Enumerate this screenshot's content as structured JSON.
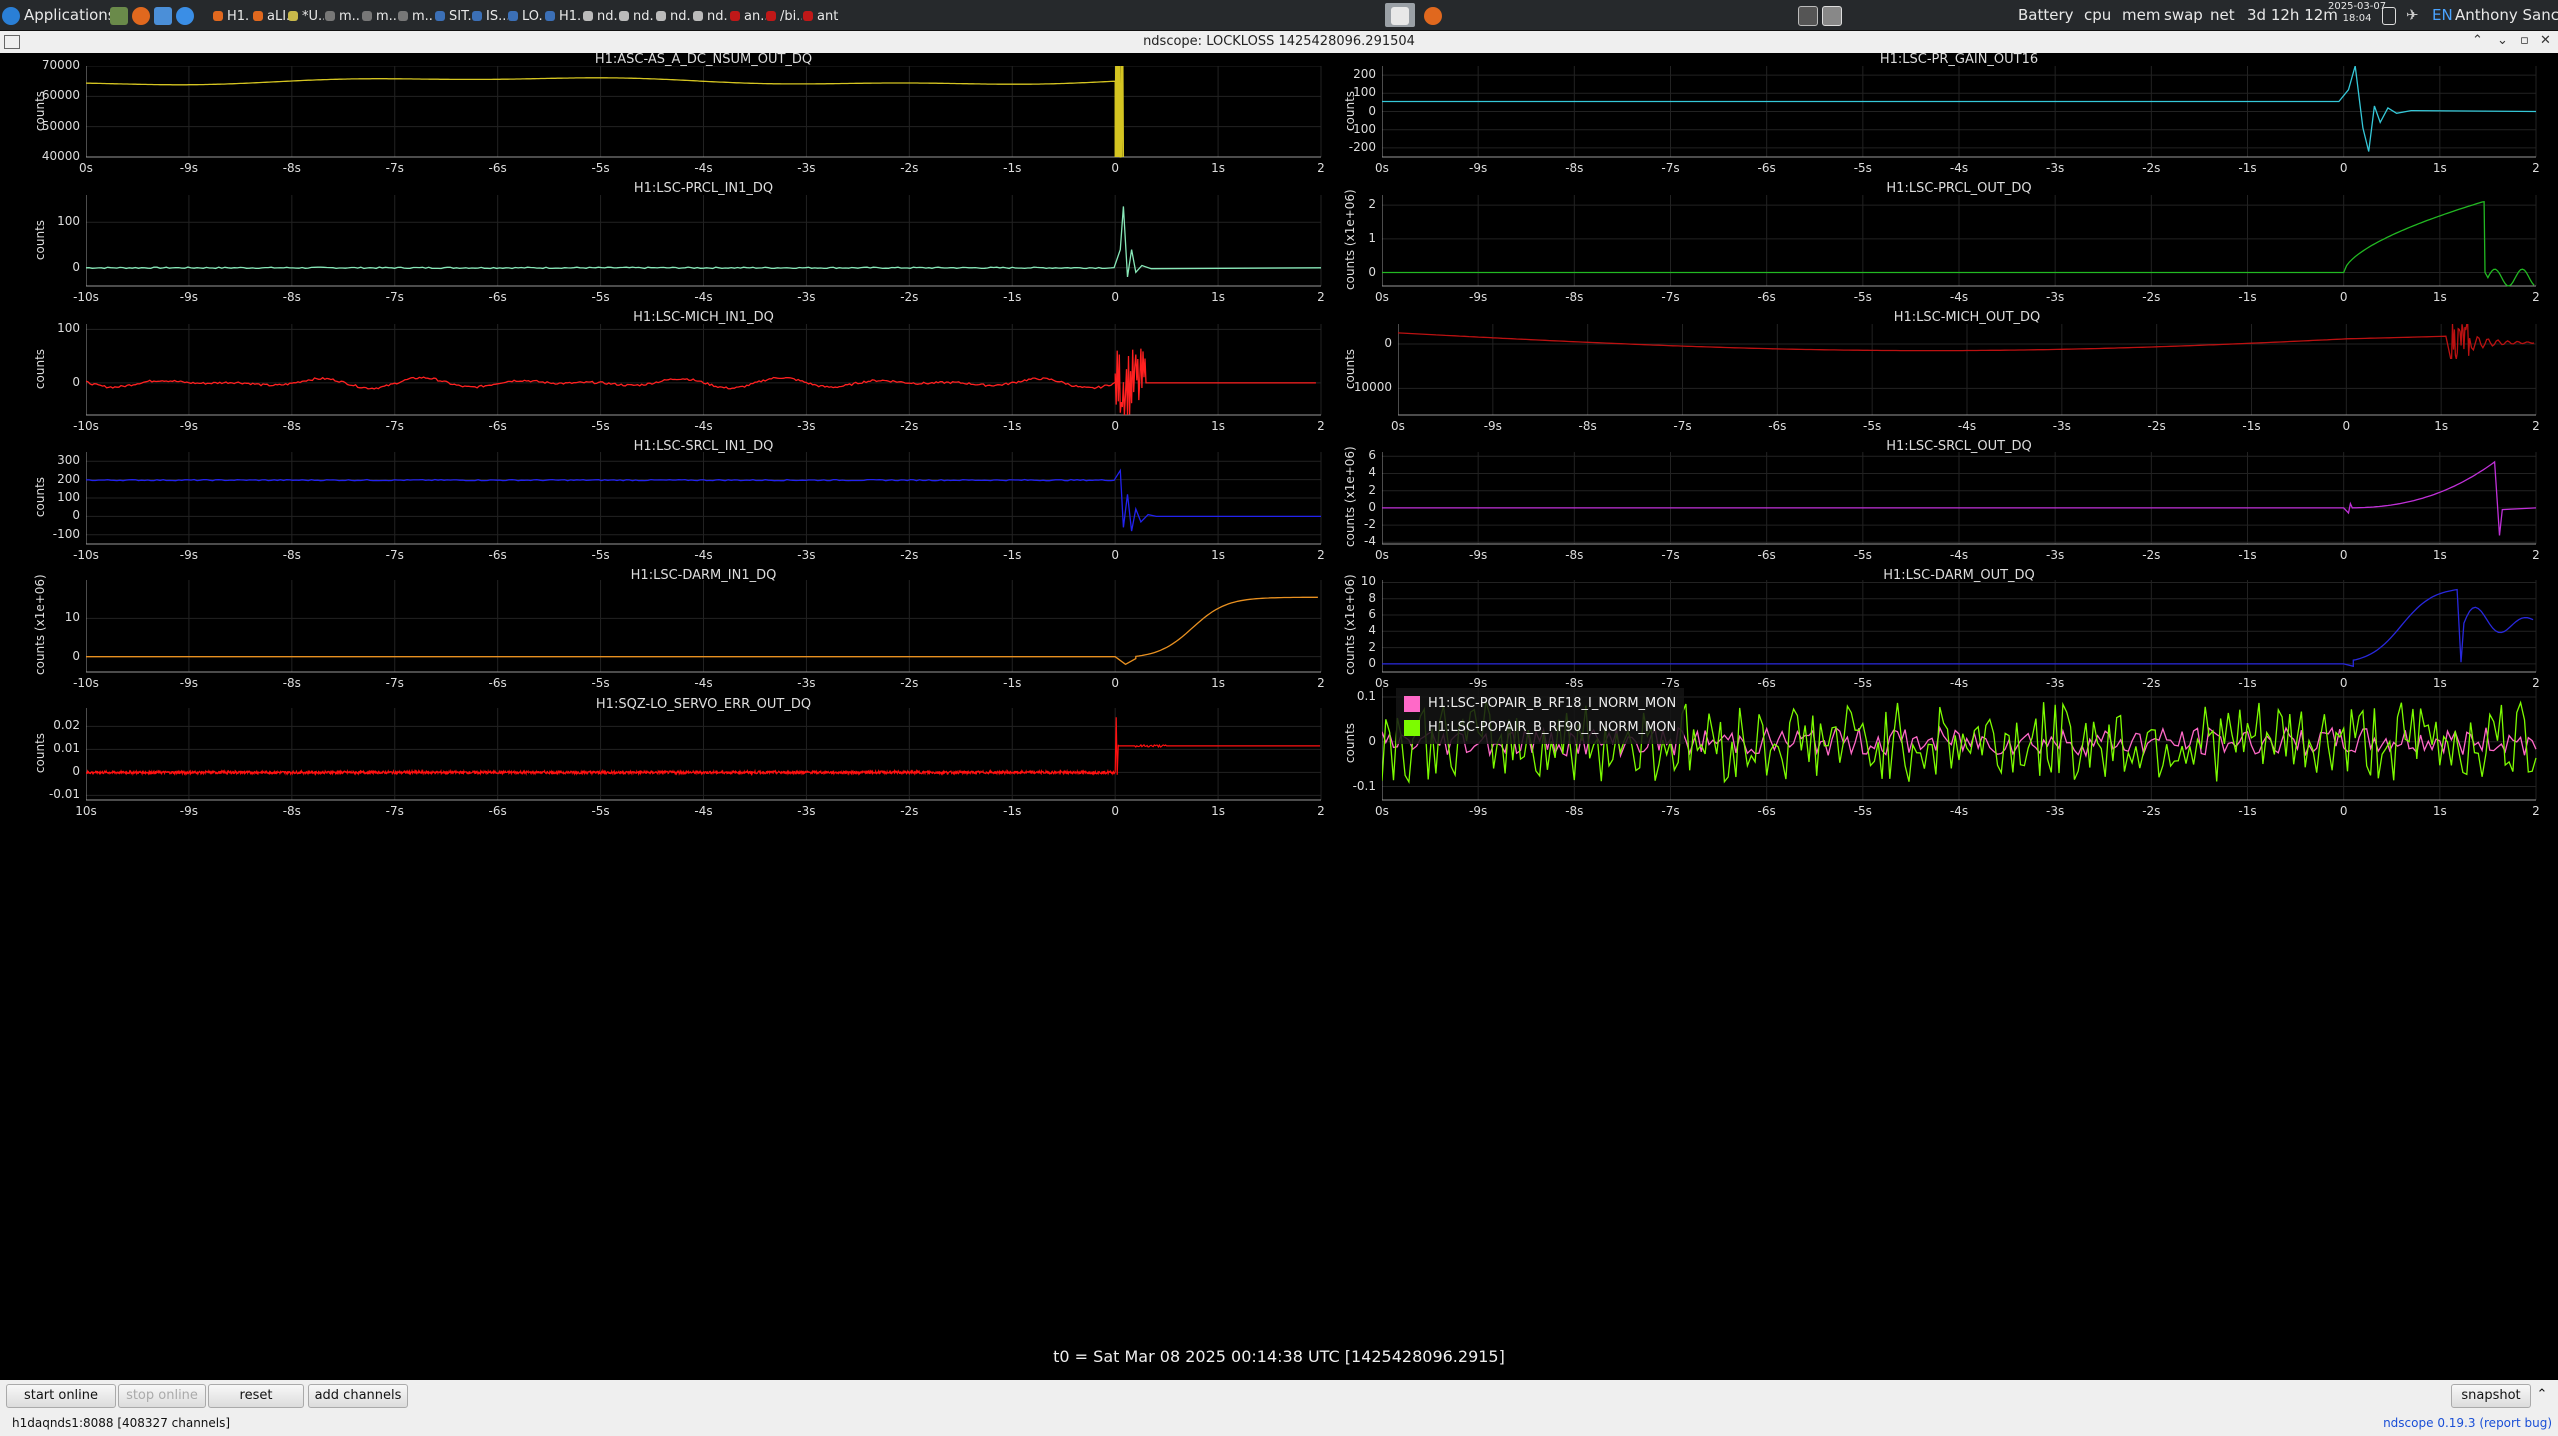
{
  "taskbar": {
    "apps_label": "Applications",
    "tasks": [
      "H1...",
      "aLI...",
      "*U...",
      "m...",
      "m...",
      "m...",
      "SIT...",
      "IS...",
      "LO...",
      "H1...",
      "nd...",
      "nd...",
      "nd...",
      "nd...",
      "an...",
      "/bi...",
      "ant..."
    ],
    "tray": {
      "battery": "Battery",
      "cpu": "cpu",
      "mem": "mem",
      "swap": "swap",
      "net": "net",
      "uptime": "3d 12h 12m",
      "date": "2025-03-07",
      "time": "18:04",
      "lang": "EN",
      "user": "Anthony Sanchez"
    },
    "colors": {
      "bg": "#26292c"
    }
  },
  "window": {
    "title": "ndscope: LOCKLOSS 1425428096.291504"
  },
  "plots": [
    {
      "id": "p1",
      "title": "H1:ASC-AS_A_DC_NSUM_OUT_DQ",
      "ylabel": "counts",
      "yticks": [
        "70000",
        "60000",
        "50000",
        "40000"
      ],
      "xticks": [
        "0s",
        "-9s",
        "-8s",
        "-7s",
        "-6s",
        "-5s",
        "-4s",
        "-3s",
        "-2s",
        "-1s",
        "0",
        "1s",
        "2"
      ],
      "color": "#d4c421",
      "ylim": [
        40000,
        70000
      ]
    },
    {
      "id": "p2",
      "title": "H1:LSC-PR_GAIN_OUT16",
      "ylabel": "counts",
      "yticks": [
        "200",
        "100",
        "0",
        "-100",
        "-200"
      ],
      "xticks": [
        "0s",
        "-9s",
        "-8s",
        "-7s",
        "-6s",
        "-5s",
        "-4s",
        "-3s",
        "-2s",
        "-1s",
        "0",
        "1s",
        "2"
      ],
      "color": "#35c8d8",
      "ylim": [
        -250,
        250
      ]
    },
    {
      "id": "p3",
      "title": "H1:LSC-PRCL_IN1_DQ",
      "ylabel": "counts",
      "yticks": [
        "100",
        "0"
      ],
      "xticks": [
        "-10s",
        "-9s",
        "-8s",
        "-7s",
        "-6s",
        "-5s",
        "-4s",
        "-3s",
        "-2s",
        "-1s",
        "0",
        "1s",
        "2"
      ],
      "color": "#88e8b8",
      "ylim": [
        -40,
        160
      ]
    },
    {
      "id": "p4",
      "title": "H1:LSC-PRCL_OUT_DQ",
      "ylabel": "counts (x1e+06)",
      "yticks": [
        "2",
        "1",
        "0"
      ],
      "xticks": [
        "0s",
        "-9s",
        "-8s",
        "-7s",
        "-6s",
        "-5s",
        "-4s",
        "-3s",
        "-2s",
        "-1s",
        "0",
        "1s",
        "2"
      ],
      "color": "#22b822",
      "ylim": [
        -0.4,
        2.3
      ]
    },
    {
      "id": "p5",
      "title": "H1:LSC-MICH_IN1_DQ",
      "ylabel": "counts",
      "yticks": [
        "100",
        "0"
      ],
      "xticks": [
        "-10s",
        "-9s",
        "-8s",
        "-7s",
        "-6s",
        "-5s",
        "-4s",
        "-3s",
        "-2s",
        "-1s",
        "0",
        "1s",
        "2"
      ],
      "color": "#ff2020",
      "ylim": [
        -60,
        110
      ]
    },
    {
      "id": "p6",
      "title": "H1:LSC-MICH_OUT_DQ",
      "ylabel": "counts",
      "yticks": [
        "0",
        "-10000"
      ],
      "xticks": [
        "0s",
        "-9s",
        "-8s",
        "-7s",
        "-6s",
        "-5s",
        "-4s",
        "-3s",
        "-2s",
        "-1s",
        "0",
        "1s",
        "2"
      ],
      "color": "#bb1111",
      "ylim": [
        -16000,
        4500
      ]
    },
    {
      "id": "p7",
      "title": "H1:LSC-SRCL_IN1_DQ",
      "ylabel": "counts",
      "yticks": [
        "300",
        "200",
        "100",
        "0",
        "-100"
      ],
      "xticks": [
        "-10s",
        "-9s",
        "-8s",
        "-7s",
        "-6s",
        "-5s",
        "-4s",
        "-3s",
        "-2s",
        "-1s",
        "0",
        "1s",
        "2"
      ],
      "color": "#2222ee",
      "ylim": [
        -150,
        350
      ]
    },
    {
      "id": "p8",
      "title": "H1:LSC-SRCL_OUT_DQ",
      "ylabel": "counts (x1e+06)",
      "yticks": [
        "6",
        "4",
        "2",
        "0",
        "-2",
        "-4"
      ],
      "xticks": [
        "0s",
        "-9s",
        "-8s",
        "-7s",
        "-6s",
        "-5s",
        "-4s",
        "-3s",
        "-2s",
        "-1s",
        "0",
        "1s",
        "2"
      ],
      "color": "#c030d8",
      "ylim": [
        -4.2,
        6.5
      ]
    },
    {
      "id": "p9",
      "title": "H1:LSC-DARM_IN1_DQ",
      "ylabel": "counts (x1e+06)",
      "yticks": [
        "10",
        "0"
      ],
      "xticks": [
        "-10s",
        "-9s",
        "-8s",
        "-7s",
        "-6s",
        "-5s",
        "-4s",
        "-3s",
        "-2s",
        "-1s",
        "0",
        "1s",
        "2"
      ],
      "color": "#e89020",
      "ylim": [
        -4,
        20
      ]
    },
    {
      "id": "p10",
      "title": "H1:LSC-DARM_OUT_DQ",
      "ylabel": "counts (x1e+06)",
      "yticks": [
        "10",
        "8",
        "6",
        "4",
        "2",
        "0"
      ],
      "xticks": [
        "0s",
        "-9s",
        "-8s",
        "-7s",
        "-6s",
        "-5s",
        "-4s",
        "-3s",
        "-2s",
        "-1s",
        "0",
        "1s",
        "2"
      ],
      "color": "#2828dd",
      "ylim": [
        -1,
        10.3
      ]
    },
    {
      "id": "p11",
      "title": "H1:SQZ-LO_SERVO_ERR_OUT_DQ",
      "ylabel": "counts",
      "yticks": [
        "0.02",
        "0.01",
        "0",
        "-0.01"
      ],
      "xticks": [
        "10s",
        "-9s",
        "-8s",
        "-7s",
        "-6s",
        "-5s",
        "-4s",
        "-3s",
        "-2s",
        "-1s",
        "0",
        "1s",
        "2"
      ],
      "color": "#ff1010",
      "ylim": [
        -0.012,
        0.028
      ]
    },
    {
      "id": "p12",
      "title": "",
      "ylabel": "counts",
      "yticks": [
        "0.1",
        "0",
        "-0.1"
      ],
      "xticks": [
        "0s",
        "-9s",
        "-8s",
        "-7s",
        "-6s",
        "-5s",
        "-4s",
        "-3s",
        "-2s",
        "-1s",
        "0",
        "1s",
        "2"
      ],
      "color": "#ff6ec7",
      "ylim": [
        -0.13,
        0.12
      ],
      "legend": [
        {
          "name": "H1:LSC-POPAIR_B_RF18_I_NORM_MON",
          "color": "#ff69c8"
        },
        {
          "name": "H1:LSC-POPAIR_B_RF90_I_NORM_MON",
          "color": "#7cfc00"
        }
      ]
    }
  ],
  "footer": {
    "t0": "t0 = Sat Mar 08 2025 00:14:38 UTC [1425428096.2915]"
  },
  "buttons": {
    "start_online": "start online",
    "stop_online": "stop online",
    "reset": "reset",
    "add_channels": "add channels",
    "snapshot": "snapshot"
  },
  "status": {
    "server": "h1daqnds1:8088  [408327 channels]",
    "app": "ndscope",
    "version": "0.19.3",
    "report": "(report bug)"
  }
}
